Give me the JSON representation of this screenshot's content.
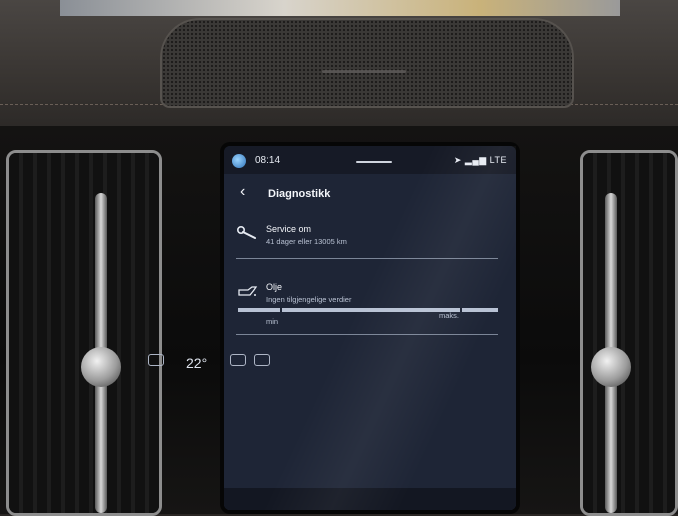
{
  "status_bar": {
    "time": "08:14",
    "network": "LTE"
  },
  "header": {
    "back_glyph": "‹",
    "title": "Diagnostikk"
  },
  "service": {
    "icon": "wrench-icon",
    "title": "Service om",
    "subtitle": "41 dager eller 13005 km"
  },
  "oil": {
    "icon": "oil-can-icon",
    "title": "Olje",
    "subtitle": "Ingen tilgjengelige verdier",
    "gauge": {
      "min_label": "min",
      "max_label": "maks.",
      "level_fraction": 1.0
    }
  },
  "climate": {
    "temperature": "22°"
  },
  "colors": {
    "screen_background": "#1e2536",
    "text_primary": "#f4f6fa",
    "text_secondary": "#b9c2d3"
  }
}
